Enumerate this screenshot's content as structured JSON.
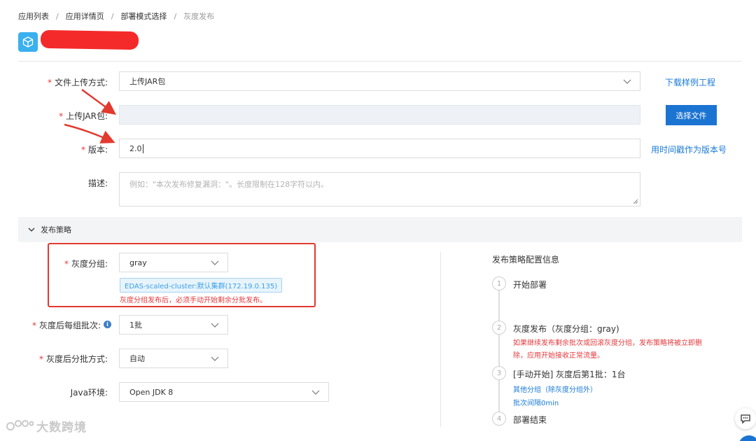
{
  "breadcrumb": {
    "item1": "应用列表",
    "item2": "应用详情页",
    "item3": "部署模式选择",
    "current": "灰度发布",
    "separator": "/"
  },
  "form": {
    "upload_method": {
      "label": "文件上传方式:",
      "value": "上传JAR包",
      "link": "下载样例工程"
    },
    "upload_jar": {
      "label": "上传JAR包:",
      "button": "选择文件"
    },
    "version": {
      "label": "版本:",
      "value": "2.0",
      "link": "用时间戳作为版本号"
    },
    "description": {
      "label": "描述:",
      "placeholder": "例如：\"本次发布修复漏洞：\"。长度限制在128字符以内。"
    }
  },
  "strategy": {
    "section_title": "发布策略",
    "gray_group": {
      "label": "灰度分组:",
      "value": "gray",
      "tag": "EDAS-scaled-cluster:默认集群(172.19.0.135)",
      "warning": "灰度分组发布后，必须手动开始剩余分批发布。"
    },
    "batches_after_gray": {
      "label": "灰度后每组批次:",
      "value": "1批"
    },
    "batch_mode": {
      "label": "灰度后分批方式:",
      "value": "自动"
    },
    "java_env": {
      "label": "Java环境:",
      "value": "Open JDK 8"
    }
  },
  "panel": {
    "title": "发布策略配置信息",
    "steps": [
      {
        "num": "1",
        "title": "开始部署"
      },
      {
        "num": "2",
        "title": "灰度发布（灰度分组：gray)",
        "note_line1": "如果继续发布剩余批次或回滚灰度分组，发布策略将被立即删",
        "note_line2": "除，应用开始接收正常流量。"
      },
      {
        "num": "3",
        "title": "[手动开始] 灰度后第1批：1台",
        "sub1": "其他分组（除灰度分组外）",
        "sub2": "批次间隔0min"
      },
      {
        "num": "4",
        "title": "部署结束"
      }
    ]
  },
  "watermark": "大数跨境",
  "colors": {
    "primary": "#1c74d2",
    "link": "#1a7ad6",
    "required": "#e4393c",
    "annotation": "#e23a2f",
    "tag_text": "#3aa0e8"
  }
}
